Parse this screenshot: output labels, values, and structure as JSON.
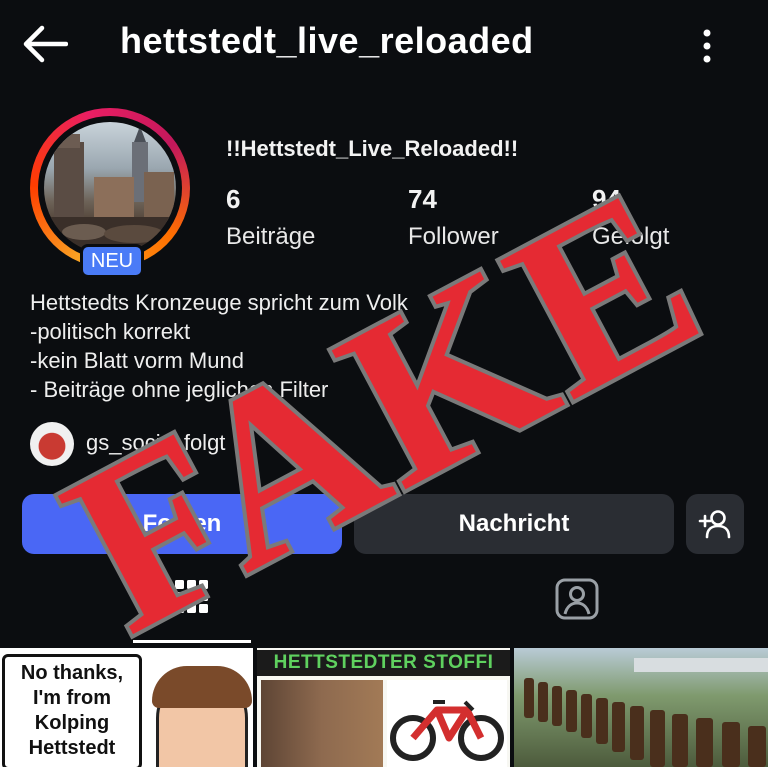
{
  "header": {
    "username": "hettstedt_live_reloaded",
    "back_icon": "arrow-left-icon",
    "more_icon": "more-vertical-icon"
  },
  "profile": {
    "display_name": "!!Hettstedt_Live_Reloaded!!",
    "badge": "NEU",
    "stats": [
      {
        "value": "6",
        "label": "Beiträge"
      },
      {
        "value": "74",
        "label": "Follower"
      },
      {
        "value": "94",
        "label": "Gefolgt"
      }
    ],
    "bio_lines": [
      "Hettstedts Kronzeuge spricht zum Volk",
      "-politisch korrekt",
      "-kein Blatt vorm Mund",
      "- Beiträge ohne jeglichen Filter"
    ],
    "followed_by": "gs_social folgt"
  },
  "actions": {
    "follow_label": "Folgen",
    "message_label": "Nachricht",
    "add_user_icon": "person-add-icon"
  },
  "tabs": {
    "grid_icon": "grid-icon",
    "tagged_icon": "tagged-person-icon"
  },
  "thumbnails": {
    "post1_text_lines": [
      "No thanks,",
      "I'm from",
      "Kolping",
      "Hettstedt"
    ],
    "post2_title": "HETTSTEDTER STOFFI"
  },
  "overlay": {
    "stamp_text": "FAKE",
    "stamp_color": "#e52a33"
  },
  "colors": {
    "background": "#0b0d10",
    "accent": "#4a67f5",
    "button_secondary": "#2a2d33"
  }
}
